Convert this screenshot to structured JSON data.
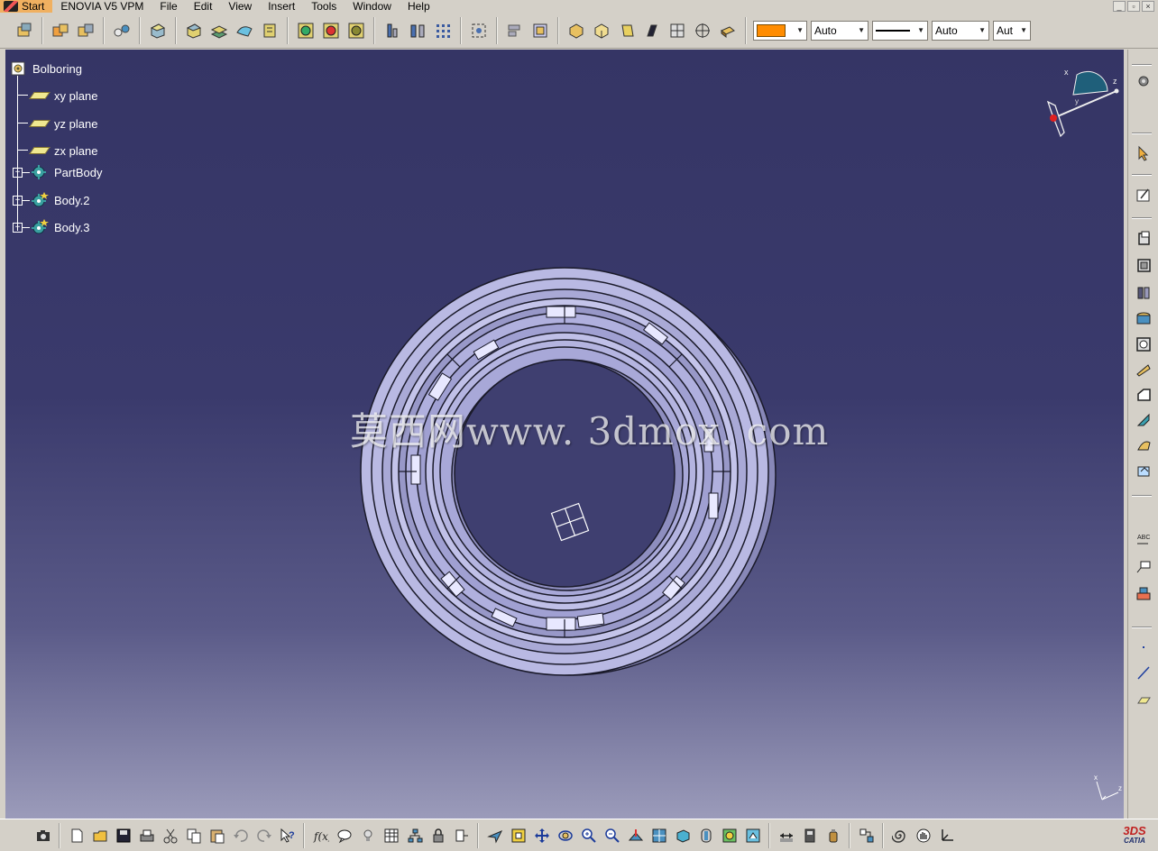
{
  "menubar": {
    "items": [
      {
        "label": "Start",
        "name": "menu-start"
      },
      {
        "label": "ENOVIA V5 VPM",
        "name": "menu-enovia"
      },
      {
        "label": "File",
        "name": "menu-file"
      },
      {
        "label": "Edit",
        "name": "menu-edit"
      },
      {
        "label": "View",
        "name": "menu-view"
      },
      {
        "label": "Insert",
        "name": "menu-insert"
      },
      {
        "label": "Tools",
        "name": "menu-tools"
      },
      {
        "label": "Window",
        "name": "menu-window"
      },
      {
        "label": "Help",
        "name": "menu-help"
      }
    ],
    "window_controls": [
      "_",
      "▫",
      "×"
    ]
  },
  "properties": {
    "fill_color": "#ff8c00",
    "transparency_value": "Auto",
    "line_thickness_value": "Auto",
    "line_weight_value": "Aut"
  },
  "tree": {
    "root": "Bolboring",
    "planes": [
      "xy plane",
      "yz plane",
      "zx plane"
    ],
    "bodies": [
      "PartBody",
      "Body.2",
      "Body.3"
    ]
  },
  "viewport": {
    "watermark": "莫西网www. 3dmox. com",
    "compass_axes": {
      "x": "x",
      "y": "y",
      "z": "z"
    },
    "mini_axes": {
      "x": "x",
      "z": "z"
    }
  },
  "catia_logo": {
    "ds": "3DS",
    "product": "CATIA"
  },
  "colors": {
    "background_top": "#353565",
    "background_bottom": "#9b9bba",
    "part_fill": "#b9b9e3",
    "accent_orange": "#ff8c00"
  }
}
